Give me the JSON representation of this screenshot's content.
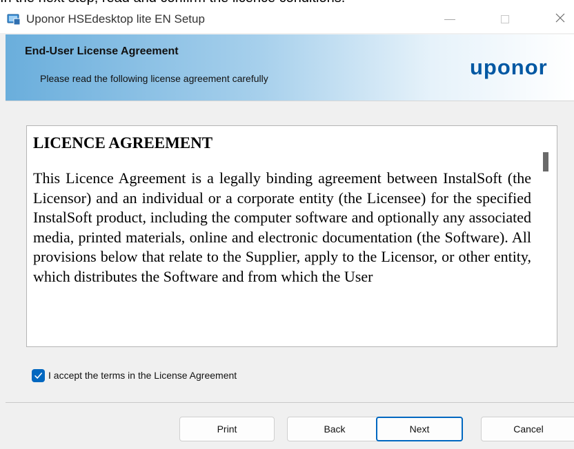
{
  "document_text": "In the next step, read and confirm the licence conditions.",
  "window": {
    "title": "Uponor HSEdesktop lite EN Setup",
    "icon": "installer-icon",
    "controls": {
      "minimize": "minimize-icon",
      "maximize": "maximize-icon",
      "close": "close-icon"
    }
  },
  "banner": {
    "title": "End-User License Agreement",
    "subtitle": "Please read the following license agreement carefully",
    "logo": "uponor"
  },
  "license": {
    "heading": "LICENCE AGREEMENT",
    "body": "This Licence Agreement is a legally binding agreement between InstalSoft (the Licensor) and an individual or a corporate entity (the Licensee) for the specified InstalSoft product, including the computer software and optionally any associated media, printed materials, online and electronic documentation (the Software). All provisions below that relate to the Supplier, apply to the Licensor, or other entity, which distributes the Software and from which the User"
  },
  "accept": {
    "label": "I accept the terms in the License Agreement",
    "checked": true
  },
  "buttons": {
    "print": "Print",
    "back": "Back",
    "next": "Next",
    "cancel": "Cancel"
  },
  "colors": {
    "accent": "#0067c0",
    "logo": "#0058a3"
  }
}
